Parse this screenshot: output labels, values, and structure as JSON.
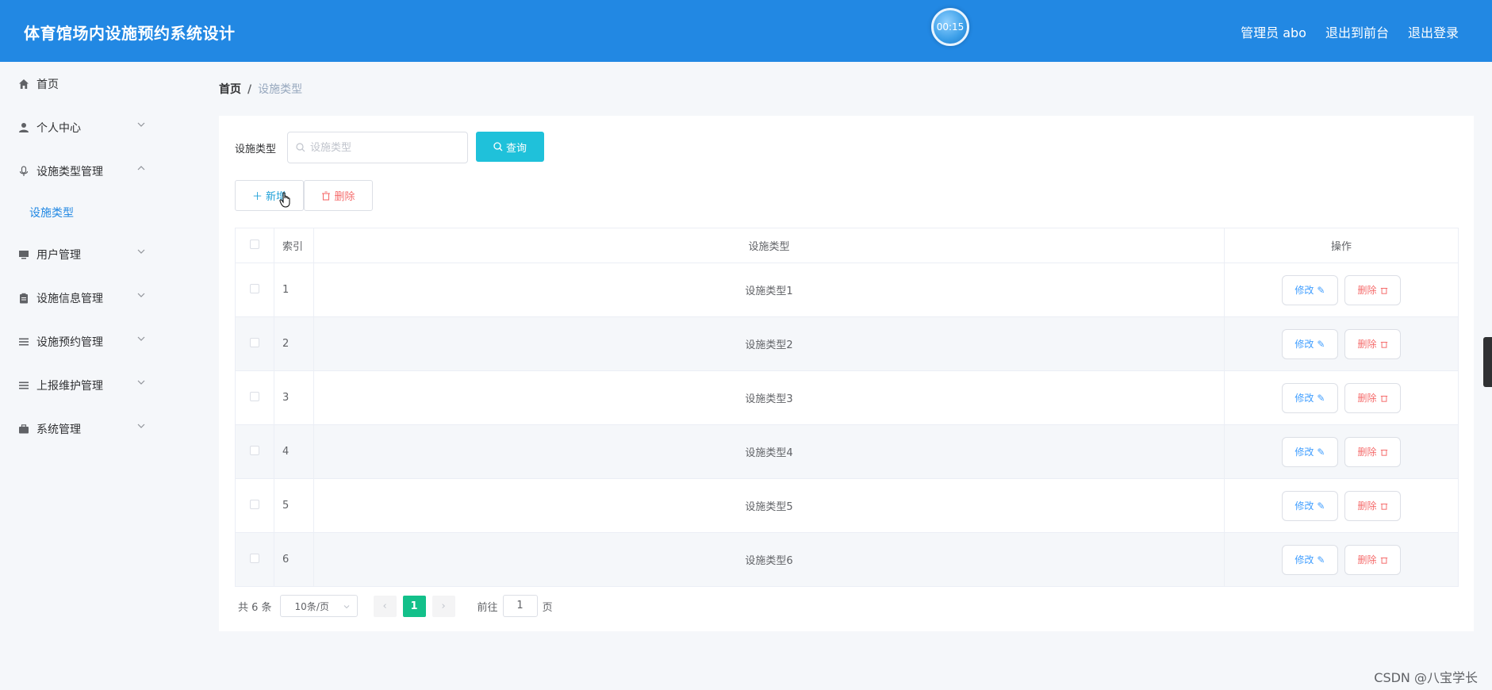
{
  "header": {
    "title": "体育馆场内设施预约系统设计",
    "timer": "00:15",
    "admin_label": "管理员 abo",
    "back_to_front": "退出到前台",
    "logout": "退出登录"
  },
  "sidebar": {
    "items": [
      {
        "label": "首页",
        "icon": "home-icon"
      },
      {
        "label": "个人中心",
        "icon": "user-icon"
      },
      {
        "label": "设施类型管理",
        "icon": "microphone-icon"
      },
      {
        "label": "设施类型",
        "icon": ""
      },
      {
        "label": "用户管理",
        "icon": "monitor-icon"
      },
      {
        "label": "设施信息管理",
        "icon": "clipboard-icon"
      },
      {
        "label": "设施预约管理",
        "icon": "list-icon"
      },
      {
        "label": "上报维护管理",
        "icon": "list-icon"
      },
      {
        "label": "系统管理",
        "icon": "briefcase-icon"
      }
    ]
  },
  "breadcrumb": {
    "home": "首页",
    "separator": "/",
    "current": "设施类型"
  },
  "search": {
    "label": "设施类型",
    "placeholder": "设施类型",
    "button": "查询"
  },
  "toolbar": {
    "add": "新增",
    "delete": "删除"
  },
  "table": {
    "headers": {
      "index": "索引",
      "type": "设施类型",
      "ops": "操作"
    },
    "edit_label": "修改",
    "delete_label": "删除",
    "rows": [
      {
        "index": "1",
        "type": "设施类型1"
      },
      {
        "index": "2",
        "type": "设施类型2"
      },
      {
        "index": "3",
        "type": "设施类型3"
      },
      {
        "index": "4",
        "type": "设施类型4"
      },
      {
        "index": "5",
        "type": "设施类型5"
      },
      {
        "index": "6",
        "type": "设施类型6"
      }
    ]
  },
  "pagination": {
    "total": "共 6 条",
    "page_size": "10条/页",
    "current_page": "1",
    "goto_label": "前往",
    "goto_value": "1",
    "page_suffix": "页"
  },
  "watermark": "CSDN @八宝学长",
  "colors": {
    "header": "#2288e3",
    "query_button": "#1fc1da",
    "active_page": "#13c08a",
    "danger": "#f56c6c",
    "primary": "#409eff"
  }
}
